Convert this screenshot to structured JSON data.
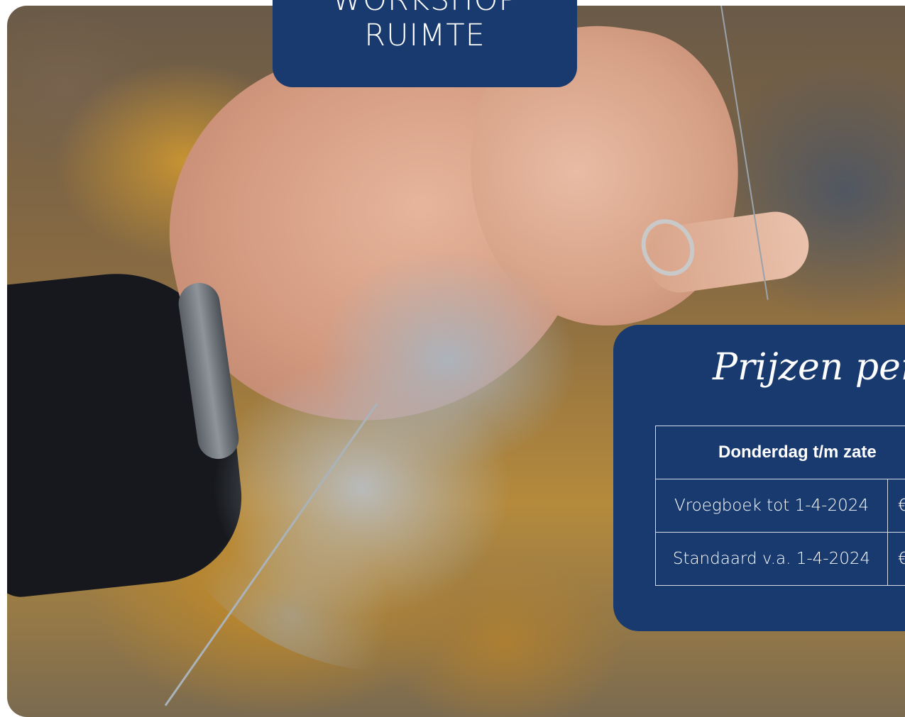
{
  "badge": {
    "line1": "WORKSHOP",
    "line2": "RUIMTE"
  },
  "prices": {
    "title": "Prijzen per d",
    "header": "Donderdag t/m zate",
    "rows": [
      {
        "label": "Vroegboek tot 1-4-2024",
        "value": "€"
      },
      {
        "label": "Standaard v.a. 1-4-2024",
        "value": "€"
      }
    ]
  },
  "colors": {
    "navy": "#193a6f",
    "white": "#ffffff"
  },
  "icons": {
    "background": "photo-hand-spinning-wool"
  }
}
